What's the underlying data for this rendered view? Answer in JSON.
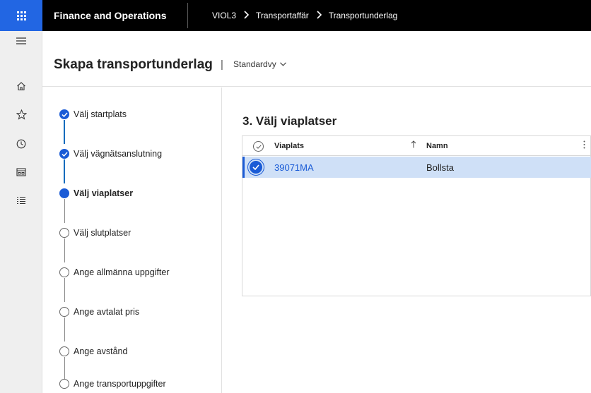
{
  "app": {
    "title": "Finance and Operations"
  },
  "breadcrumb": [
    "VIOL3",
    "Transportaffär",
    "Transportunderlag"
  ],
  "header": {
    "title": "Skapa transportunderlag",
    "separator": "|",
    "view": "Standardvy"
  },
  "steps": [
    {
      "label": "Välj startplats",
      "state": "done"
    },
    {
      "label": "Välj vägnätsanslutning",
      "state": "done"
    },
    {
      "label": "Välj viaplatser",
      "state": "current"
    },
    {
      "label": "Välj slutplatser",
      "state": "todo"
    },
    {
      "label": "Ange allmänna uppgifter",
      "state": "todo"
    },
    {
      "label": "Ange avtalat pris",
      "state": "todo"
    },
    {
      "label": "Ange avstånd",
      "state": "todo"
    },
    {
      "label": "Ange transportuppgifter",
      "state": "todo"
    }
  ],
  "main": {
    "section_title": "3. Välj viaplatser",
    "grid": {
      "columns": {
        "via": "Viaplats",
        "namn": "Namn"
      },
      "sort": "ascending",
      "rows": [
        {
          "via": "39071MA",
          "namn": "Bollsta",
          "selected": true
        }
      ]
    }
  },
  "icons": {
    "nav": [
      "hamburger-icon",
      "home-icon",
      "star-icon",
      "clock-icon",
      "workspace-icon",
      "list-icon"
    ]
  },
  "colors": {
    "accent": "#1a5bd6",
    "waffle_bg": "#2266e3",
    "selected_row": "#cfe0f7"
  }
}
